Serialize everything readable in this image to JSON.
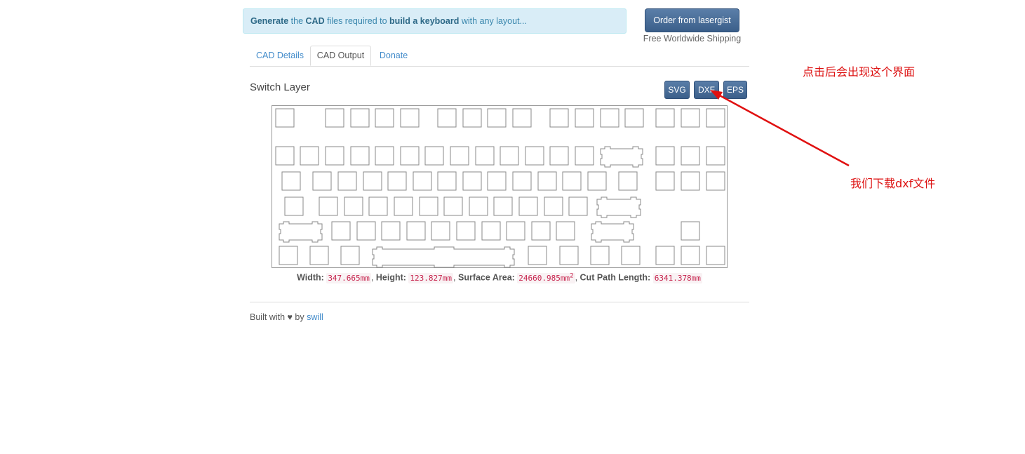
{
  "banner": {
    "segments": [
      {
        "text": "Generate",
        "bold": true
      },
      {
        "text": " the ",
        "bold": false
      },
      {
        "text": "CAD",
        "bold": true
      },
      {
        "text": " files required to ",
        "bold": false
      },
      {
        "text": "build a keyboard",
        "bold": true
      },
      {
        "text": " with any layout...",
        "bold": false
      }
    ]
  },
  "order": {
    "label": "Order from lasergist",
    "shipping": "Free Worldwide Shipping"
  },
  "tabs": [
    {
      "label": "CAD Details",
      "active": false
    },
    {
      "label": "CAD Output",
      "active": true
    },
    {
      "label": "Donate",
      "active": false
    }
  ],
  "layer": {
    "title": "Switch Layer"
  },
  "formats": [
    "SVG",
    "DXF",
    "EPS"
  ],
  "dimensions": {
    "width_label": "Width:",
    "width": "347.665mm",
    "height_label": "Height:",
    "height": "123.827mm",
    "area_label": "Surface Area:",
    "area": "24660.985mm",
    "area_sup": "2",
    "cut_label": "Cut Path Length:",
    "cut": "6341.378mm"
  },
  "footer": {
    "prefix": "Built with",
    "heart": "♥",
    "by": "by",
    "author": "swill"
  },
  "annotations": {
    "top": "点击后会出现这个界面",
    "bottom": "我们下载dxf文件",
    "color": "#dd1111"
  },
  "colors": {
    "accent": "#3b5f8a",
    "link": "#428bca",
    "banner_bg": "#d9edf7"
  }
}
